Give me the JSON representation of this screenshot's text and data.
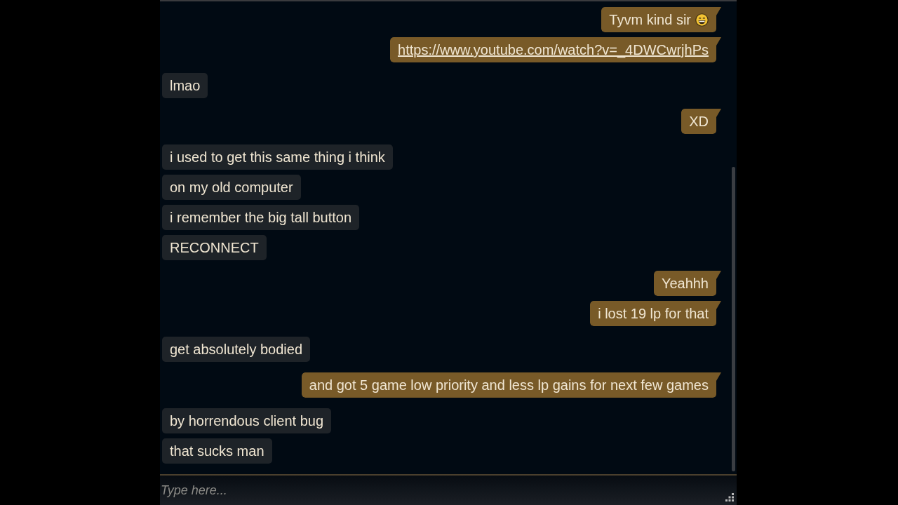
{
  "messages": [
    {
      "kind": "smiley",
      "outgoing": true,
      "text": "Tyvm kind sir"
    },
    {
      "kind": "link",
      "outgoing": true,
      "text": "https://www.youtube.com/watch?v=_4DWCwrjhPs"
    },
    {
      "kind": "text",
      "outgoing": false,
      "text": "lmao"
    },
    {
      "kind": "text",
      "outgoing": true,
      "text": "XD"
    },
    {
      "kind": "text",
      "outgoing": false,
      "text": "i used to get this same thing i think"
    },
    {
      "kind": "text",
      "outgoing": false,
      "text": "on my old computer"
    },
    {
      "kind": "text",
      "outgoing": false,
      "text": "i remember the big tall button"
    },
    {
      "kind": "text",
      "outgoing": false,
      "text": "RECONNECT"
    },
    {
      "kind": "text",
      "outgoing": true,
      "text": "Yeahhh"
    },
    {
      "kind": "text",
      "outgoing": true,
      "text": "i lost 19 lp for that"
    },
    {
      "kind": "text",
      "outgoing": false,
      "text": "get absolutely bodied"
    },
    {
      "kind": "text",
      "outgoing": true,
      "text": "and got 5 game low priority and less lp gains for next few games"
    },
    {
      "kind": "text",
      "outgoing": false,
      "text": "by horrendous client bug"
    },
    {
      "kind": "text",
      "outgoing": false,
      "text": "that sucks man"
    }
  ],
  "input": {
    "placeholder": "Type here..."
  }
}
